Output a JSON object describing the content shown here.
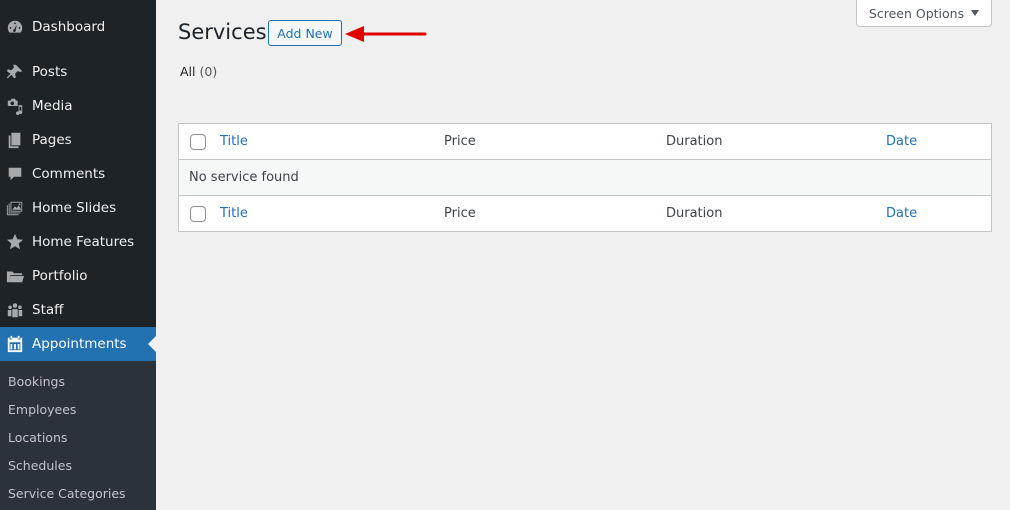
{
  "sidebar": {
    "items": [
      {
        "label": "Dashboard",
        "icon": "dashboard-icon"
      },
      {
        "label": "Posts",
        "icon": "pin-icon"
      },
      {
        "label": "Media",
        "icon": "media-icon"
      },
      {
        "label": "Pages",
        "icon": "pages-icon"
      },
      {
        "label": "Comments",
        "icon": "comment-icon"
      },
      {
        "label": "Home Slides",
        "icon": "slides-icon"
      },
      {
        "label": "Home Features",
        "icon": "star-icon"
      },
      {
        "label": "Portfolio",
        "icon": "folder-icon"
      },
      {
        "label": "Staff",
        "icon": "groups-icon"
      },
      {
        "label": "Appointments",
        "icon": "calendar-icon",
        "current": true
      }
    ],
    "submenu": [
      "Bookings",
      "Employees",
      "Locations",
      "Schedules",
      "Service Categories"
    ]
  },
  "header": {
    "title": "Services",
    "add_new_label": "Add New",
    "screen_options_label": "Screen Options"
  },
  "filter": {
    "all_label": "All",
    "all_count": "(0)"
  },
  "table": {
    "columns": [
      "Title",
      "Price",
      "Duration",
      "Date"
    ],
    "empty_message": "No service found"
  },
  "colors": {
    "accent": "#2271b1",
    "sidebar_bg": "#1d2327",
    "annotation_arrow": "#e00000"
  }
}
